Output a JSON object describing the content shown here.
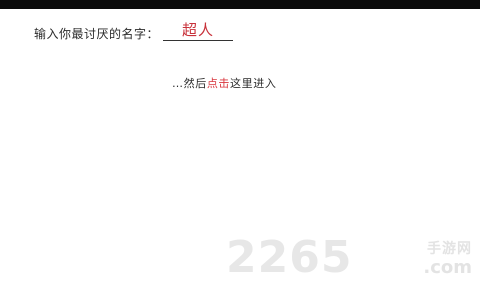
{
  "name_prompt": {
    "label": "输入你最讨厌的名字：",
    "value": "超人"
  },
  "enter_link": {
    "prefix": "…然后",
    "highlight": "点击",
    "suffix": "这里进入"
  },
  "watermark": {
    "number": "2265",
    "site_name": "手游网",
    "domain": ".com"
  },
  "colors": {
    "accent_red": "#c8313a",
    "top_bar": "#0b0b0b"
  }
}
